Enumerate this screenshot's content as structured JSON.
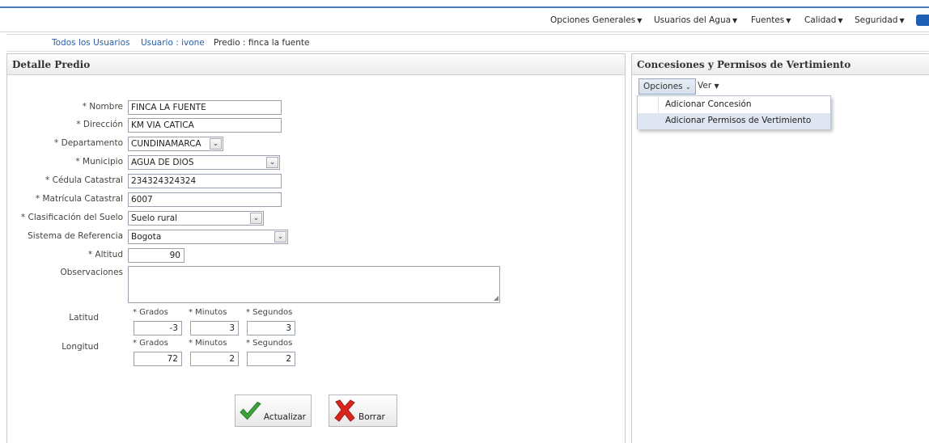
{
  "menu": {
    "items": [
      {
        "label": "Opciones Generales"
      },
      {
        "label": "Usuarios del Agua"
      },
      {
        "label": "Fuentes"
      },
      {
        "label": "Calidad"
      },
      {
        "label": "Seguridad"
      }
    ]
  },
  "breadcrumb": {
    "all_users": "Todos los Usuarios",
    "user": "Usuario : ivone",
    "predio": "Predio : finca la fuente"
  },
  "detail": {
    "title": "Detalle Predio",
    "nombre_label": "* Nombre",
    "nombre_value": "FINCA LA FUENTE",
    "direccion_label": "* Dirección",
    "direccion_value": "KM  VIA CATICA",
    "departamento_label": "* Departamento",
    "departamento_value": "CUNDINAMARCA",
    "municipio_label": "* Municipio",
    "municipio_value": "AGUA DE DIOS",
    "cedula_label": "* Cédula Catastral",
    "cedula_value": "234324324324",
    "matricula_label": "* Matrícula Catastral",
    "matricula_value": "6007",
    "clasificacion_label": "* Clasificación del Suelo",
    "clasificacion_value": "Suelo rural",
    "sistema_label": "Sistema de Referencia",
    "sistema_value": "Bogota",
    "altitud_label": "* Altitud",
    "altitud_value": "90",
    "observaciones_label": "Observaciones",
    "observaciones_value": "",
    "latitud_label": "Latitud",
    "longitud_label": "Longitud",
    "grados_label": "* Grados",
    "minutos_label": "* Minutos",
    "segundos_label": "* Segundos",
    "lat_grados": "-3",
    "lat_minutos": "3",
    "lat_segundos": "3",
    "lon_grados": "72",
    "lon_minutos": "2",
    "lon_segundos": "2",
    "update_button": "Actualizar",
    "delete_button": "Borrar"
  },
  "concessions": {
    "title": "Concesiones y Permisos de Vertimiento",
    "options_label": "Opciones",
    "view_label": "Ver",
    "dropdown_items": [
      {
        "label": "Adicionar Concesión"
      },
      {
        "label": "Adicionar Permisos de Vertimiento"
      }
    ]
  },
  "colors": {
    "accent": "#4a78b5",
    "link": "#2b5ea7",
    "hover": "#dfe6f1",
    "check": "#3aa33a",
    "cross": "#d9261c"
  }
}
